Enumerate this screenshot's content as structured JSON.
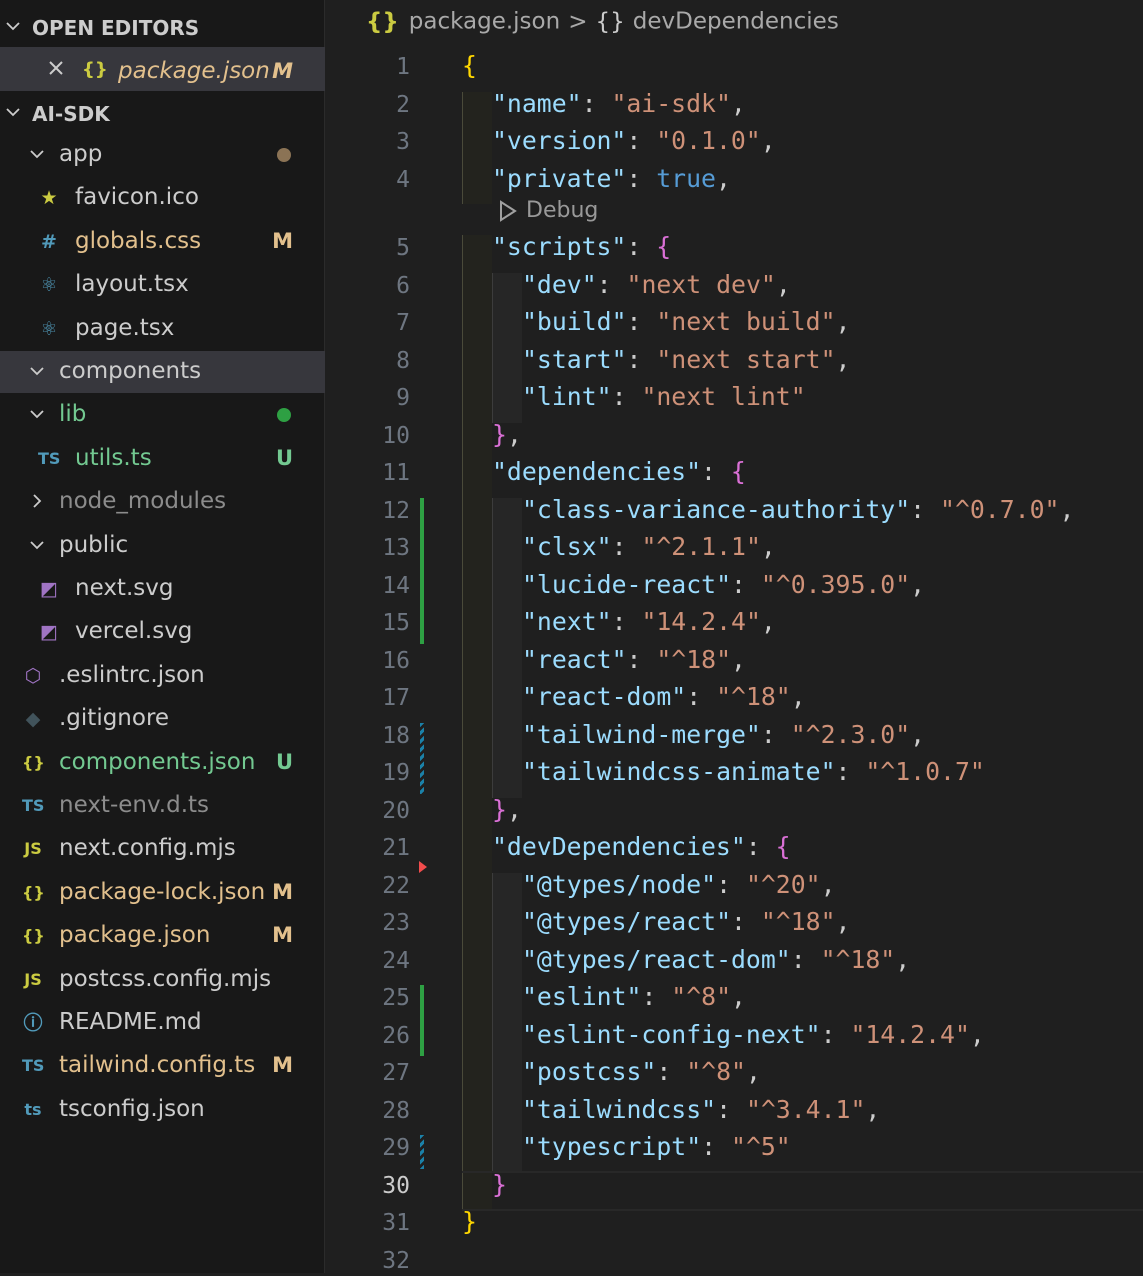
{
  "explorer": {
    "open_editors": {
      "title": "OPEN EDITORS",
      "files": [
        {
          "name": "package.json",
          "status": "M",
          "icon": "json-braces-icon"
        }
      ]
    },
    "project": {
      "title": "AI-SDK",
      "items": [
        {
          "name": "app",
          "kind": "folder",
          "expanded": true,
          "depth": 1,
          "dot": "#8b7355"
        },
        {
          "name": "favicon.ico",
          "kind": "file",
          "depth": 2,
          "icon": "star-icon",
          "color": "#cccccc"
        },
        {
          "name": "globals.css",
          "kind": "file",
          "depth": 2,
          "icon": "hash-icon",
          "color": "#e2c08d",
          "status": "M"
        },
        {
          "name": "layout.tsx",
          "kind": "file",
          "depth": 2,
          "icon": "react-icon",
          "color": "#cccccc"
        },
        {
          "name": "page.tsx",
          "kind": "file",
          "depth": 2,
          "icon": "react-icon",
          "color": "#cccccc"
        },
        {
          "name": "components",
          "kind": "folder",
          "expanded": true,
          "depth": 1
        },
        {
          "name": "lib",
          "kind": "folder",
          "expanded": true,
          "depth": 1,
          "dot": "#2ea043",
          "color": "#73c991"
        },
        {
          "name": "utils.ts",
          "kind": "file",
          "depth": 2,
          "icon": "ts-icon",
          "color": "#73c991",
          "status": "U"
        },
        {
          "name": "node_modules",
          "kind": "folder",
          "expanded": false,
          "depth": 1,
          "color": "#8c8c8c"
        },
        {
          "name": "public",
          "kind": "folder",
          "expanded": true,
          "depth": 1
        },
        {
          "name": "next.svg",
          "kind": "file",
          "depth": 2,
          "icon": "svg-icon",
          "color": "#cccccc"
        },
        {
          "name": "vercel.svg",
          "kind": "file",
          "depth": 2,
          "icon": "svg-icon",
          "color": "#cccccc"
        },
        {
          "name": ".eslintrc.json",
          "kind": "file",
          "depth": 1,
          "icon": "eslint-icon",
          "color": "#cccccc"
        },
        {
          "name": ".gitignore",
          "kind": "file",
          "depth": 1,
          "icon": "git-icon",
          "color": "#cccccc"
        },
        {
          "name": "components.json",
          "kind": "file",
          "depth": 1,
          "icon": "json-braces-icon",
          "color": "#73c991",
          "status": "U"
        },
        {
          "name": "next-env.d.ts",
          "kind": "file",
          "depth": 1,
          "icon": "ts-icon",
          "color": "#8c8c8c"
        },
        {
          "name": "next.config.mjs",
          "kind": "file",
          "depth": 1,
          "icon": "js-icon",
          "color": "#cccccc"
        },
        {
          "name": "package-lock.json",
          "kind": "file",
          "depth": 1,
          "icon": "json-braces-icon",
          "color": "#e2c08d",
          "status": "M"
        },
        {
          "name": "package.json",
          "kind": "file",
          "depth": 1,
          "icon": "json-braces-icon",
          "color": "#e2c08d",
          "status": "M"
        },
        {
          "name": "postcss.config.mjs",
          "kind": "file",
          "depth": 1,
          "icon": "js-icon",
          "color": "#cccccc"
        },
        {
          "name": "README.md",
          "kind": "file",
          "depth": 1,
          "icon": "info-icon",
          "color": "#cccccc"
        },
        {
          "name": "tailwind.config.ts",
          "kind": "file",
          "depth": 1,
          "icon": "ts-icon",
          "color": "#e2c08d",
          "status": "M"
        },
        {
          "name": "tsconfig.json",
          "kind": "file",
          "depth": 1,
          "icon": "tsconfig-icon",
          "color": "#cccccc"
        }
      ]
    }
  },
  "editor": {
    "breadcrumb": {
      "file": "package.json",
      "separator": ">",
      "symbol": "devDependencies",
      "file_icon": "{}",
      "symbol_icon": "{}"
    },
    "codelens": "Debug",
    "current_line": 30,
    "lines": [
      {
        "n": 1,
        "indent": 0,
        "tokens": [
          [
            "p1",
            "{"
          ]
        ]
      },
      {
        "n": 2,
        "indent": 1,
        "tokens": [
          [
            "k",
            "\"name\""
          ],
          [
            "t",
            ": "
          ],
          [
            "s",
            "\"ai-sdk\""
          ],
          [
            "t",
            ","
          ]
        ]
      },
      {
        "n": 3,
        "indent": 1,
        "tokens": [
          [
            "k",
            "\"version\""
          ],
          [
            "t",
            ": "
          ],
          [
            "s",
            "\"0.1.0\""
          ],
          [
            "t",
            ","
          ]
        ]
      },
      {
        "n": 4,
        "indent": 1,
        "tokens": [
          [
            "k",
            "\"private\""
          ],
          [
            "t",
            ": "
          ],
          [
            "b",
            "true"
          ],
          [
            "t",
            ","
          ]
        ]
      },
      {
        "n": 5,
        "indent": 1,
        "tokens": [
          [
            "k",
            "\"scripts\""
          ],
          [
            "t",
            ": "
          ],
          [
            "p2",
            "{"
          ]
        ]
      },
      {
        "n": 6,
        "indent": 2,
        "tokens": [
          [
            "k",
            "\"dev\""
          ],
          [
            "t",
            ": "
          ],
          [
            "s",
            "\"next dev\""
          ],
          [
            "t",
            ","
          ]
        ]
      },
      {
        "n": 7,
        "indent": 2,
        "tokens": [
          [
            "k",
            "\"build\""
          ],
          [
            "t",
            ": "
          ],
          [
            "s",
            "\"next build\""
          ],
          [
            "t",
            ","
          ]
        ]
      },
      {
        "n": 8,
        "indent": 2,
        "tokens": [
          [
            "k",
            "\"start\""
          ],
          [
            "t",
            ": "
          ],
          [
            "s",
            "\"next start\""
          ],
          [
            "t",
            ","
          ]
        ]
      },
      {
        "n": 9,
        "indent": 2,
        "tokens": [
          [
            "k",
            "\"lint\""
          ],
          [
            "t",
            ": "
          ],
          [
            "s",
            "\"next lint\""
          ]
        ]
      },
      {
        "n": 10,
        "indent": 1,
        "tokens": [
          [
            "p2",
            "}"
          ],
          [
            "t",
            ","
          ]
        ]
      },
      {
        "n": 11,
        "indent": 1,
        "tokens": [
          [
            "k",
            "\"dependencies\""
          ],
          [
            "t",
            ": "
          ],
          [
            "p2",
            "{"
          ]
        ]
      },
      {
        "n": 12,
        "indent": 2,
        "tokens": [
          [
            "k",
            "\"class-variance-authority\""
          ],
          [
            "t",
            ": "
          ],
          [
            "s",
            "\"^0.7.0\""
          ],
          [
            "t",
            ","
          ]
        ]
      },
      {
        "n": 13,
        "indent": 2,
        "tokens": [
          [
            "k",
            "\"clsx\""
          ],
          [
            "t",
            ": "
          ],
          [
            "s",
            "\"^2.1.1\""
          ],
          [
            "t",
            ","
          ]
        ]
      },
      {
        "n": 14,
        "indent": 2,
        "tokens": [
          [
            "k",
            "\"lucide-react\""
          ],
          [
            "t",
            ": "
          ],
          [
            "s",
            "\"^0.395.0\""
          ],
          [
            "t",
            ","
          ]
        ]
      },
      {
        "n": 15,
        "indent": 2,
        "tokens": [
          [
            "k",
            "\"next\""
          ],
          [
            "t",
            ": "
          ],
          [
            "s",
            "\"14.2.4\""
          ],
          [
            "t",
            ","
          ]
        ]
      },
      {
        "n": 16,
        "indent": 2,
        "tokens": [
          [
            "k",
            "\"react\""
          ],
          [
            "t",
            ": "
          ],
          [
            "s",
            "\"^18\""
          ],
          [
            "t",
            ","
          ]
        ]
      },
      {
        "n": 17,
        "indent": 2,
        "tokens": [
          [
            "k",
            "\"react-dom\""
          ],
          [
            "t",
            ": "
          ],
          [
            "s",
            "\"^18\""
          ],
          [
            "t",
            ","
          ]
        ]
      },
      {
        "n": 18,
        "indent": 2,
        "tokens": [
          [
            "k",
            "\"tailwind-merge\""
          ],
          [
            "t",
            ": "
          ],
          [
            "s",
            "\"^2.3.0\""
          ],
          [
            "t",
            ","
          ]
        ]
      },
      {
        "n": 19,
        "indent": 2,
        "tokens": [
          [
            "k",
            "\"tailwindcss-animate\""
          ],
          [
            "t",
            ": "
          ],
          [
            "s",
            "\"^1.0.7\""
          ]
        ]
      },
      {
        "n": 20,
        "indent": 1,
        "tokens": [
          [
            "p2",
            "}"
          ],
          [
            "t",
            ","
          ]
        ]
      },
      {
        "n": 21,
        "indent": 1,
        "tokens": [
          [
            "k",
            "\"devDependencies\""
          ],
          [
            "t",
            ": "
          ],
          [
            "p2",
            "{"
          ]
        ]
      },
      {
        "n": 22,
        "indent": 2,
        "tokens": [
          [
            "k",
            "\"@types/node\""
          ],
          [
            "t",
            ": "
          ],
          [
            "s",
            "\"^20\""
          ],
          [
            "t",
            ","
          ]
        ]
      },
      {
        "n": 23,
        "indent": 2,
        "tokens": [
          [
            "k",
            "\"@types/react\""
          ],
          [
            "t",
            ": "
          ],
          [
            "s",
            "\"^18\""
          ],
          [
            "t",
            ","
          ]
        ]
      },
      {
        "n": 24,
        "indent": 2,
        "tokens": [
          [
            "k",
            "\"@types/react-dom\""
          ],
          [
            "t",
            ": "
          ],
          [
            "s",
            "\"^18\""
          ],
          [
            "t",
            ","
          ]
        ]
      },
      {
        "n": 25,
        "indent": 2,
        "tokens": [
          [
            "k",
            "\"eslint\""
          ],
          [
            "t",
            ": "
          ],
          [
            "s",
            "\"^8\""
          ],
          [
            "t",
            ","
          ]
        ]
      },
      {
        "n": 26,
        "indent": 2,
        "tokens": [
          [
            "k",
            "\"eslint-config-next\""
          ],
          [
            "t",
            ": "
          ],
          [
            "s",
            "\"14.2.4\""
          ],
          [
            "t",
            ","
          ]
        ]
      },
      {
        "n": 27,
        "indent": 2,
        "tokens": [
          [
            "k",
            "\"postcss\""
          ],
          [
            "t",
            ": "
          ],
          [
            "s",
            "\"^8\""
          ],
          [
            "t",
            ","
          ]
        ]
      },
      {
        "n": 28,
        "indent": 2,
        "tokens": [
          [
            "k",
            "\"tailwindcss\""
          ],
          [
            "t",
            ": "
          ],
          [
            "s",
            "\"^3.4.1\""
          ],
          [
            "t",
            ","
          ]
        ]
      },
      {
        "n": 29,
        "indent": 2,
        "tokens": [
          [
            "k",
            "\"typescript\""
          ],
          [
            "t",
            ": "
          ],
          [
            "s",
            "\"^5\""
          ]
        ]
      },
      {
        "n": 30,
        "indent": 1,
        "tokens": [
          [
            "p2",
            "}"
          ]
        ]
      },
      {
        "n": 31,
        "indent": 0,
        "tokens": [
          [
            "p1",
            "}"
          ]
        ]
      },
      {
        "n": 32,
        "indent": 0,
        "tokens": []
      }
    ]
  }
}
